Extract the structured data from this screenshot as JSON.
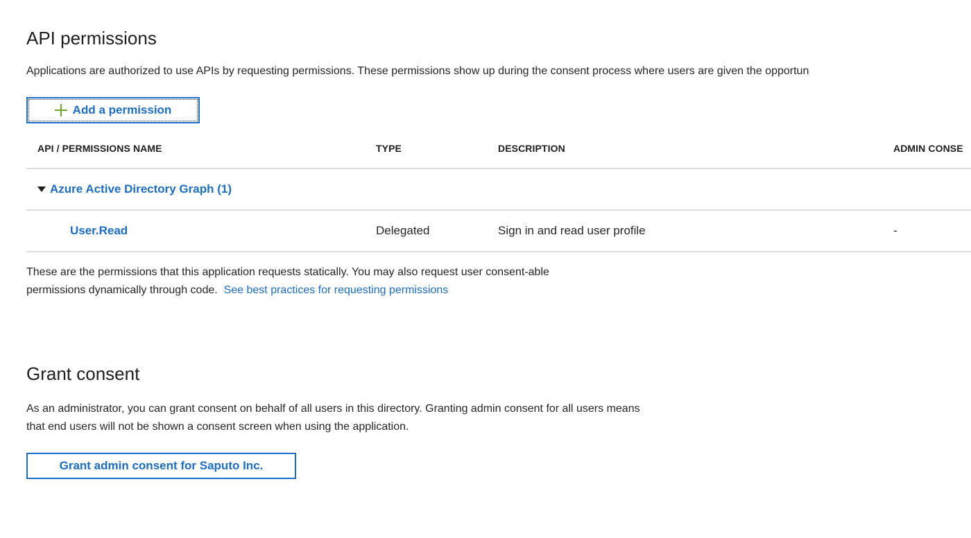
{
  "api_permissions": {
    "title": "API permissions",
    "description": "Applications are authorized to use APIs by requesting permissions. These permissions show up during the consent process where users are given the opportun",
    "add_button_label": "Add a permission",
    "add_button_icon": "plus-icon",
    "table": {
      "columns": [
        "API / PERMISSIONS NAME",
        "TYPE",
        "DESCRIPTION",
        "ADMIN CONSE"
      ],
      "groups": [
        {
          "label": "Azure Active Directory Graph (1)",
          "expanded": true,
          "icon": "caret-down-icon",
          "rows": [
            {
              "name": "User.Read",
              "type": "Delegated",
              "description": "Sign in and read user profile",
              "admin_consent": "-"
            }
          ]
        }
      ]
    },
    "footnote_line1": "These are the permissions that this application requests statically. You may also request user consent-able",
    "footnote_line2": "permissions dynamically through code. ",
    "footnote_link": "See best practices for requesting permissions"
  },
  "grant_consent": {
    "title": "Grant consent",
    "description_line1": "As an administrator, you can grant consent on behalf of all users in this directory. Granting admin consent for all users means",
    "description_line2": "that end users will not be shown a consent screen when using the application.",
    "button_label": "Grant admin consent for Saputo Inc."
  },
  "colors": {
    "accent": "#1a6ec7",
    "plus_icon": "#6aaa22",
    "divider": "#dcdcdc",
    "text": "#1e1e1e"
  }
}
